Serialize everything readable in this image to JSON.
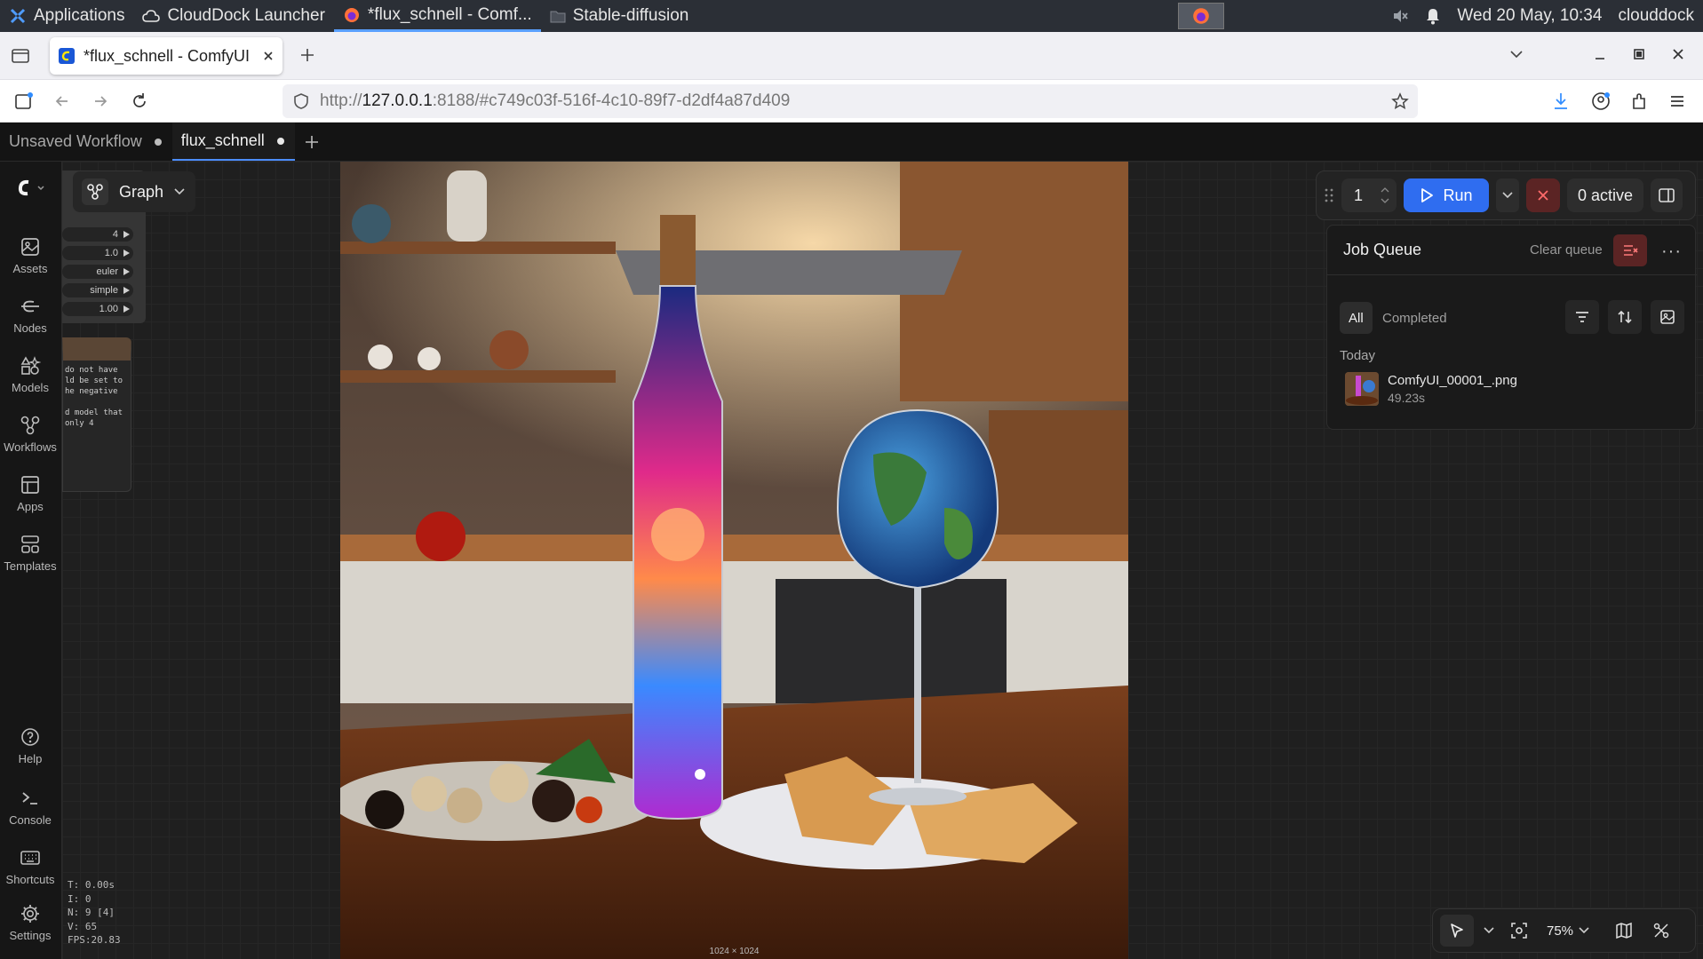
{
  "os": {
    "applications": "Applications",
    "taskbar": [
      {
        "label": "CloudDock Launcher"
      },
      {
        "label": "*flux_schnell - Comf..."
      },
      {
        "label": "Stable-diffusion"
      }
    ],
    "clock": "Wed 20 May, 10:34",
    "user": "clouddock"
  },
  "browser": {
    "tab_title": "*flux_schnell - ComfyUI",
    "url_scheme": "http://",
    "url_host": "127.0.0.1",
    "url_rest": ":8188/#c749c03f-516f-4c10-89f7-d2df4a87d409"
  },
  "workflow_tabs": [
    {
      "label": "Unsaved Workflow"
    },
    {
      "label": "flux_schnell"
    }
  ],
  "sidebar": {
    "top": [
      {
        "label": "Assets"
      },
      {
        "label": "Nodes"
      },
      {
        "label": "Models"
      },
      {
        "label": "Workflows"
      },
      {
        "label": "Apps"
      },
      {
        "label": "Templates"
      }
    ],
    "bottom": [
      {
        "label": "Help"
      },
      {
        "label": "Console"
      },
      {
        "label": "Shortcuts"
      },
      {
        "label": "Settings"
      }
    ]
  },
  "graph_toggle": {
    "label": "Graph"
  },
  "node_widgets": [
    {
      "value": "4"
    },
    {
      "value": "1.0"
    },
    {
      "value": "euler"
    },
    {
      "value": "simple"
    },
    {
      "value": "1.00"
    }
  ],
  "note_text": "do not have\nld be set to\nhe negative\n\nd model that\nonly 4",
  "run_toolbar": {
    "batch": "1",
    "run_label": "Run",
    "active": "0 active"
  },
  "job_queue": {
    "title": "Job Queue",
    "clear_label": "Clear queue",
    "filters": [
      {
        "label": "All"
      },
      {
        "label": "Completed"
      }
    ],
    "group": "Today",
    "items": [
      {
        "name": "ComfyUI_00001_.png",
        "time": "49.23s"
      }
    ]
  },
  "preview": {
    "size_label": "1024 × 1024"
  },
  "stats": {
    "t": "T: 0.00s",
    "i": "I: 0",
    "n": "N: 9 [4]",
    "v": "V: 65",
    "fps": "FPS:20.83"
  },
  "canvas_tools": {
    "zoom": "75%"
  },
  "colors": {
    "accent": "#2f6df0",
    "danger": "#5b2424",
    "os_bar": "#2b2f36",
    "app_bg": "#1e1e1e"
  }
}
